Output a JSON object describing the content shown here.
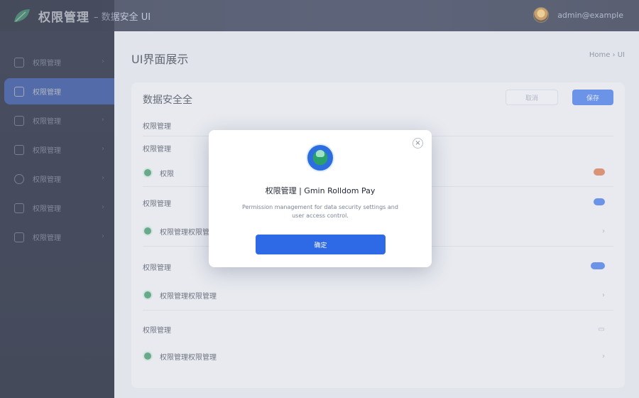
{
  "header": {
    "brand": "权限管理",
    "brand_sub": "– 数据安全 UI",
    "user_name": "admin@example"
  },
  "sidebar": {
    "items": [
      {
        "label": "权限管理",
        "icon": "document-icon"
      },
      {
        "label": "权限管理",
        "icon": "list-icon"
      },
      {
        "label": "权限管理",
        "icon": "folder-icon"
      },
      {
        "label": "权限管理",
        "icon": "shield-icon"
      },
      {
        "label": "权限管理",
        "icon": "settings-icon"
      },
      {
        "label": "权限管理",
        "icon": "grid-icon"
      },
      {
        "label": "权限管理",
        "icon": "flag-icon"
      }
    ]
  },
  "main": {
    "page_title": "UI界面展示",
    "breadcrumb": "Home › UI",
    "card_title": "数据安全全",
    "secondary_button": "取消",
    "primary_button": "保存",
    "rows": [
      {
        "text": "权限管理",
        "sub": ""
      },
      {
        "text": "权限管理",
        "sub": ""
      },
      {
        "text": "权限",
        "sub": ""
      },
      {
        "text": "权限管理",
        "sub": ""
      },
      {
        "text": "权限管理权限管理",
        "sub": "权限管理权限管理"
      },
      {
        "text": "权限管理",
        "sub": ""
      },
      {
        "text": "权限管理权限管理",
        "sub": "权限管理权限管理"
      },
      {
        "text": "权限管理",
        "sub": ""
      },
      {
        "text": "权限管理权限管理",
        "sub": "权限管理权限管理"
      }
    ]
  },
  "modal": {
    "title": "权限管理 | Gmin Rolldom Pay",
    "description": "Permission management for data security settings and user access control.",
    "button": "确定"
  },
  "colors": {
    "accent": "#2f6ae6",
    "sidebar_bg": "#141b33",
    "main_bg": "#e3e6ec"
  }
}
